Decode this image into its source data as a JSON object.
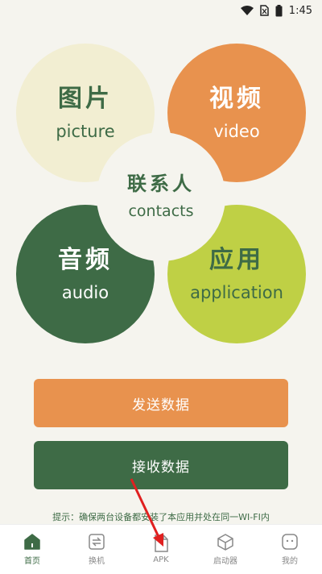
{
  "status_bar": {
    "time": "1:45"
  },
  "tiles": {
    "picture": {
      "cn": "图片",
      "en": "picture"
    },
    "video": {
      "cn": "视频",
      "en": "video"
    },
    "audio": {
      "cn": "音频",
      "en": "audio"
    },
    "application": {
      "cn": "应用",
      "en": "application"
    },
    "contacts": {
      "cn": "联系人",
      "en": "contacts"
    }
  },
  "buttons": {
    "send": "发送数据",
    "receive": "接收数据"
  },
  "hint": "提示：确保两台设备都安装了本应用并处在同一WI-FI内",
  "tabs": [
    {
      "label": "首页",
      "icon": "home-icon"
    },
    {
      "label": "换机",
      "icon": "swap-icon"
    },
    {
      "label": "APK",
      "icon": "apk-file-icon"
    },
    {
      "label": "启动器",
      "icon": "launcher-box-icon"
    },
    {
      "label": "我的",
      "icon": "profile-icon"
    }
  ],
  "colors": {
    "orange": "#e8924e",
    "green": "#3e6b46",
    "cream": "#f2eed2",
    "lime": "#bfd045",
    "annotation_arrow": "#e02020"
  }
}
